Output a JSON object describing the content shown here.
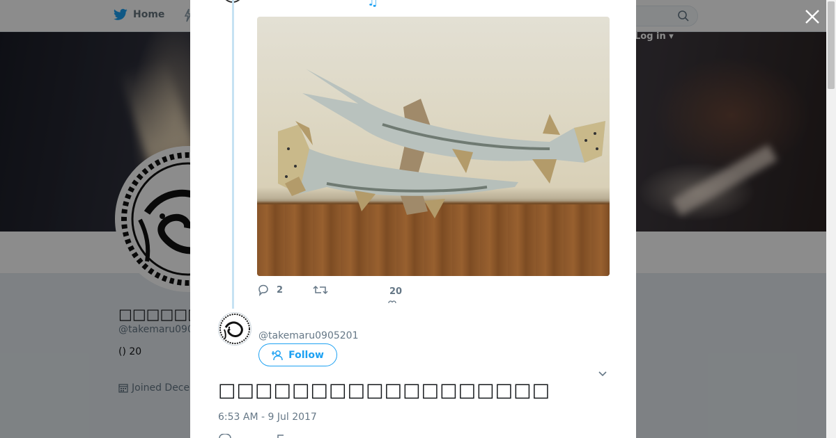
{
  "nav": {
    "home_label": "Home",
    "login_label": "Log in"
  },
  "profile": {
    "name": "□□□□□□",
    "handle": "@takemaru090",
    "bio": "() 20",
    "joined": "Joined Dece"
  },
  "tweet": {
    "prev_text": "♫",
    "reply_count": "2",
    "like_count": "20",
    "author_handle": "@takemaru0905201",
    "follow_label": "Follow",
    "text": "□□□□□□□□□□□□□□□□□□",
    "timestamp": "6:53 AM - 9 Jul 2017"
  },
  "colors": {
    "accent": "#1da1f2",
    "muted": "#657786",
    "thread_line": "#c6e2f3"
  },
  "icons": {
    "home": "twitter-bird-icon",
    "search": "search-icon",
    "close": "close-icon",
    "reply": "reply-icon",
    "retweet": "retweet-icon",
    "follow": "add-user-icon",
    "caret": "chevron-down-icon",
    "calendar": "calendar-icon"
  }
}
